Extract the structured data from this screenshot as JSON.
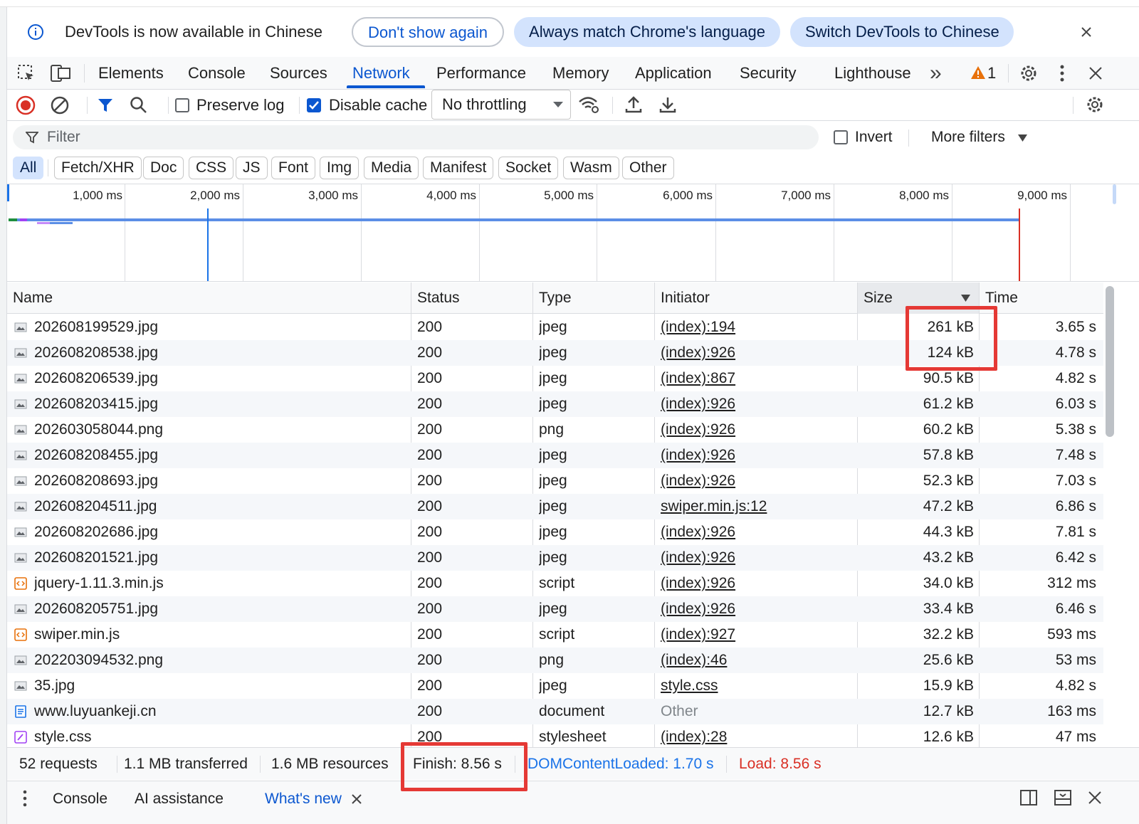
{
  "infobar": {
    "message": "DevTools is now available in Chinese",
    "dont_show": "Don't show again",
    "always_match": "Always match Chrome's language",
    "switch_label": "Switch DevTools to Chinese"
  },
  "main_tabs": {
    "elements": "Elements",
    "console": "Console",
    "sources": "Sources",
    "network": "Network",
    "performance": "Performance",
    "memory": "Memory",
    "application": "Application",
    "security": "Security",
    "lighthouse": "Lighthouse",
    "more": "»",
    "warning_count": "1"
  },
  "network_toolbar": {
    "preserve_log": "Preserve log",
    "preserve_log_checked": false,
    "disable_cache": "Disable cache",
    "disable_cache_checked": true,
    "throttling": "No throttling"
  },
  "filter": {
    "placeholder": "Filter",
    "invert": "Invert",
    "more_filters": "More filters"
  },
  "type_filters": [
    "All",
    "Fetch/XHR",
    "Doc",
    "CSS",
    "JS",
    "Font",
    "Img",
    "Media",
    "Manifest",
    "Socket",
    "Wasm",
    "Other"
  ],
  "active_type_filter": "All",
  "overview": {
    "ticks": [
      "1,000 ms",
      "2,000 ms",
      "3,000 ms",
      "4,000 ms",
      "5,000 ms",
      "6,000 ms",
      "7,000 ms",
      "8,000 ms",
      "9,000 ms"
    ],
    "dom_content_loaded_ms": 1700,
    "load_ms": 8560
  },
  "table": {
    "columns": {
      "name": "Name",
      "status": "Status",
      "type": "Type",
      "initiator": "Initiator",
      "size": "Size",
      "time": "Time"
    },
    "sort_column": "Size",
    "rows": [
      {
        "name": "202608199529.jpg",
        "status": "200",
        "type": "jpeg",
        "initiator": "(index):194",
        "size": "261 kB",
        "time": "3.65 s",
        "icon": "image-file-icon"
      },
      {
        "name": "202608208538.jpg",
        "status": "200",
        "type": "jpeg",
        "initiator": "(index):926",
        "size": "124 kB",
        "time": "4.78 s",
        "icon": "image-file-icon"
      },
      {
        "name": "202608206539.jpg",
        "status": "200",
        "type": "jpeg",
        "initiator": "(index):867",
        "size": "90.5 kB",
        "time": "4.82 s",
        "icon": "image-file-icon"
      },
      {
        "name": "202608203415.jpg",
        "status": "200",
        "type": "jpeg",
        "initiator": "(index):926",
        "size": "61.2 kB",
        "time": "6.03 s",
        "icon": "image-file-icon"
      },
      {
        "name": "202603058044.png",
        "status": "200",
        "type": "png",
        "initiator": "(index):926",
        "size": "60.2 kB",
        "time": "5.38 s",
        "icon": "image-file-icon"
      },
      {
        "name": "202608208455.jpg",
        "status": "200",
        "type": "jpeg",
        "initiator": "(index):926",
        "size": "57.8 kB",
        "time": "7.48 s",
        "icon": "image-file-icon"
      },
      {
        "name": "202608208693.jpg",
        "status": "200",
        "type": "jpeg",
        "initiator": "(index):926",
        "size": "52.3 kB",
        "time": "7.03 s",
        "icon": "image-file-icon"
      },
      {
        "name": "202608204511.jpg",
        "status": "200",
        "type": "jpeg",
        "initiator": "swiper.min.js:12",
        "size": "47.2 kB",
        "time": "6.86 s",
        "icon": "image-file-icon"
      },
      {
        "name": "202608202686.jpg",
        "status": "200",
        "type": "jpeg",
        "initiator": "(index):926",
        "size": "44.3 kB",
        "time": "7.81 s",
        "icon": "image-file-icon"
      },
      {
        "name": "202608201521.jpg",
        "status": "200",
        "type": "jpeg",
        "initiator": "(index):926",
        "size": "43.2 kB",
        "time": "6.42 s",
        "icon": "image-file-icon"
      },
      {
        "name": "jquery-1.11.3.min.js",
        "status": "200",
        "type": "script",
        "initiator": "(index):926",
        "size": "34.0 kB",
        "time": "312 ms",
        "icon": "script-file-icon"
      },
      {
        "name": "202608205751.jpg",
        "status": "200",
        "type": "jpeg",
        "initiator": "(index):926",
        "size": "33.4 kB",
        "time": "6.46 s",
        "icon": "image-file-icon"
      },
      {
        "name": "swiper.min.js",
        "status": "200",
        "type": "script",
        "initiator": "(index):927",
        "size": "32.2 kB",
        "time": "593 ms",
        "icon": "script-file-icon"
      },
      {
        "name": "202203094532.png",
        "status": "200",
        "type": "png",
        "initiator": "(index):46",
        "size": "25.6 kB",
        "time": "53 ms",
        "icon": "image-file-icon"
      },
      {
        "name": "35.jpg",
        "status": "200",
        "type": "jpeg",
        "initiator": "style.css",
        "size": "15.9 kB",
        "time": "4.82 s",
        "icon": "image-file-icon"
      },
      {
        "name": "www.luyuankeji.cn",
        "status": "200",
        "type": "document",
        "initiator": "Other",
        "size": "12.7 kB",
        "time": "163 ms",
        "icon": "document-file-icon"
      },
      {
        "name": "style.css",
        "status": "200",
        "type": "stylesheet",
        "initiator": "(index):28",
        "size": "12.6 kB",
        "time": "47 ms",
        "icon": "stylesheet-file-icon"
      }
    ]
  },
  "summary": {
    "requests": "52 requests",
    "transferred": "1.1 MB transferred",
    "resources": "1.6 MB resources",
    "finish": "Finish: 8.56 s",
    "dom_content_loaded": "DOMContentLoaded: 1.70 s",
    "load": "Load: 8.56 s"
  },
  "drawer": {
    "console": "Console",
    "ai_assistance": "AI assistance",
    "whats_new": "What's new"
  },
  "colors": {
    "accent": "#0b57d0",
    "highlight_box": "#e53935",
    "dom_content_loaded": "#1a73e8",
    "load": "#d93025",
    "warning": "#e8710a"
  }
}
